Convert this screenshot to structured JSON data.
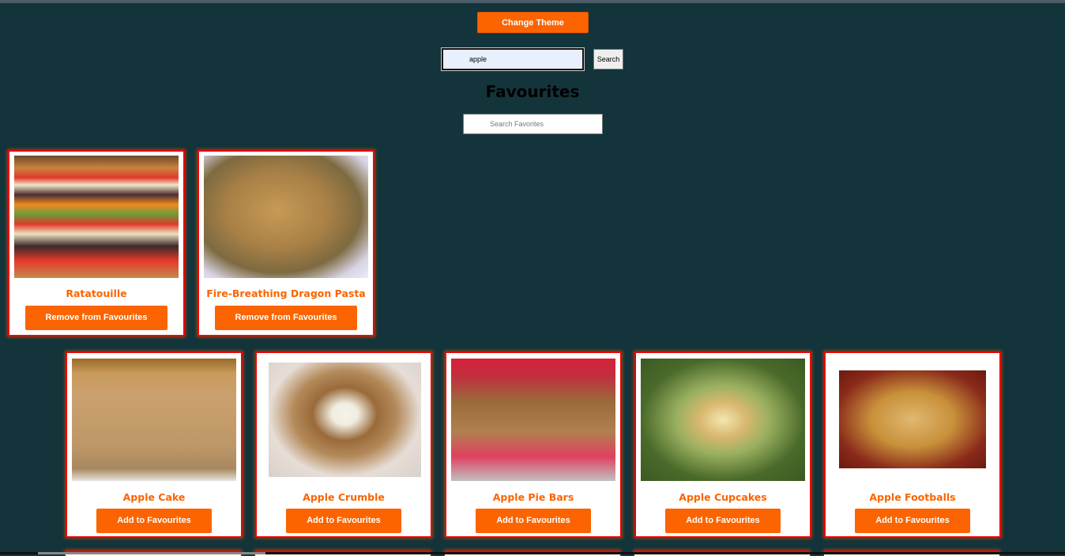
{
  "header": {
    "change_theme_label": "Change Theme"
  },
  "search": {
    "value": "apple",
    "button_label": "Search"
  },
  "favourites": {
    "title": "Favourites",
    "search_placeholder": "Search Favorites",
    "items": [
      {
        "name": "Ratatouille",
        "button": "Remove from Favourites"
      },
      {
        "name": "Fire-Breathing Dragon Pasta",
        "button": "Remove from Favourites"
      }
    ]
  },
  "results": {
    "items": [
      {
        "name": "Apple Cake",
        "button": "Add to Favourites"
      },
      {
        "name": "Apple Crumble",
        "button": "Add to Favourites"
      },
      {
        "name": "Apple Pie Bars",
        "button": "Add to Favourites"
      },
      {
        "name": "Apple Cupcakes",
        "button": "Add to Favourites"
      },
      {
        "name": "Apple Footballs",
        "button": "Add to Favourites"
      }
    ]
  },
  "colors": {
    "background": "#13343b",
    "accent": "#fb6400",
    "card_border": "#e00000"
  }
}
